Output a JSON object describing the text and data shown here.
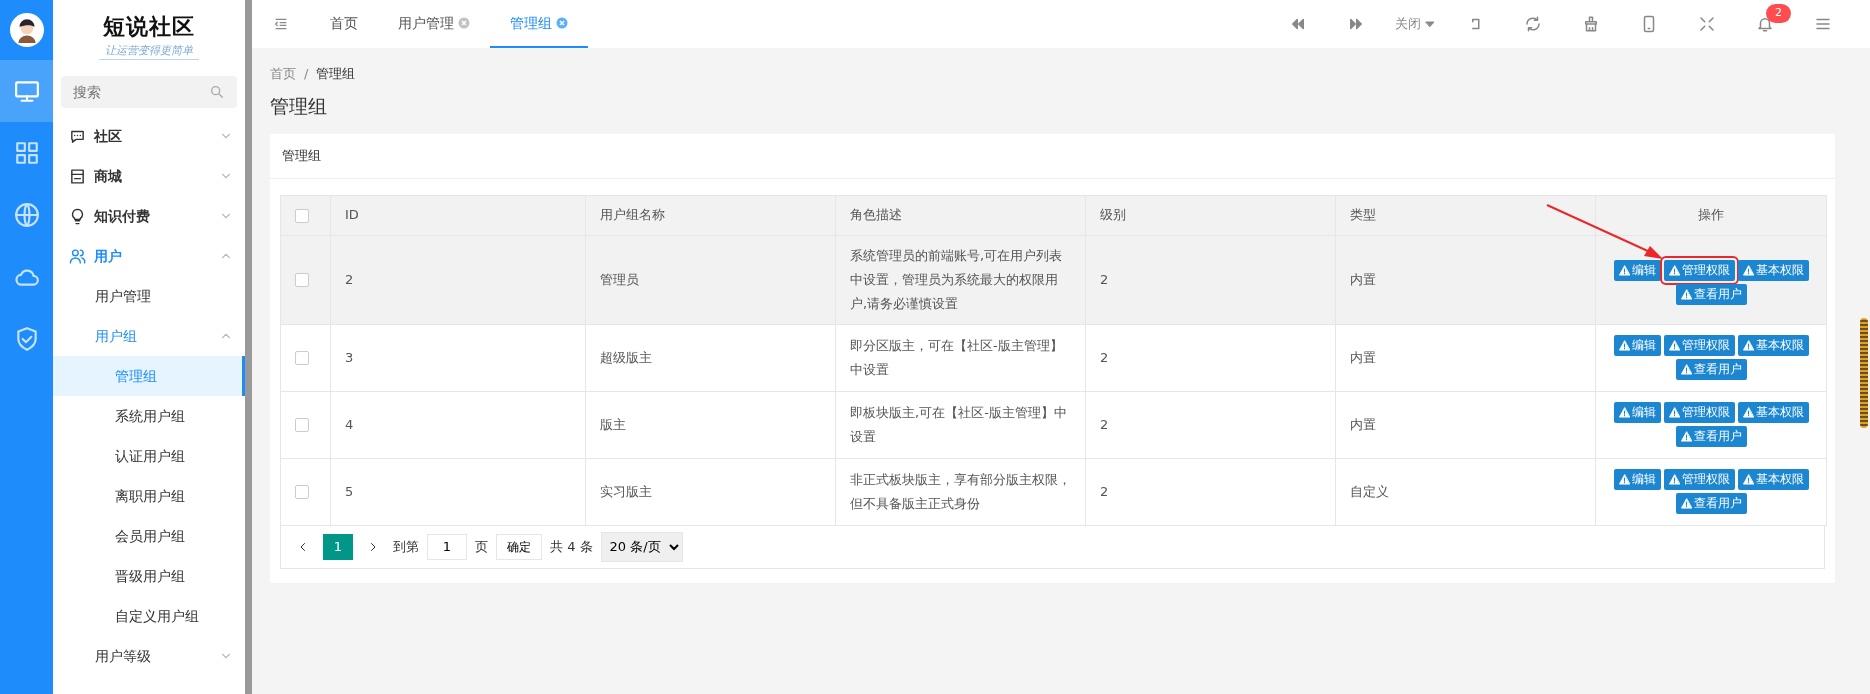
{
  "rail": [
    {
      "kind": "monitor",
      "selected": true
    },
    {
      "kind": "grid",
      "selected": false
    },
    {
      "kind": "globe",
      "selected": false
    },
    {
      "kind": "cloud",
      "selected": false
    },
    {
      "kind": "shield",
      "selected": false
    }
  ],
  "logo": {
    "title": "短说社区",
    "tagline": "让运营变得更简单"
  },
  "search": {
    "placeholder": "搜索"
  },
  "menu": [
    {
      "label": "社区",
      "kind": "chat",
      "active": false,
      "expanded": false
    },
    {
      "label": "商城",
      "kind": "store",
      "active": false,
      "expanded": false
    },
    {
      "label": "知识付费",
      "kind": "bulb",
      "active": false,
      "expanded": false
    },
    {
      "label": "用户",
      "kind": "users",
      "active": true,
      "expanded": true,
      "children": [
        {
          "label": "用户管理",
          "active": false
        },
        {
          "label": "用户组",
          "active": true,
          "expanded": true,
          "children": [
            {
              "label": "管理组",
              "selected": true
            },
            {
              "label": "系统用户组",
              "selected": false
            },
            {
              "label": "认证用户组",
              "selected": false
            },
            {
              "label": "离职用户组",
              "selected": false
            },
            {
              "label": "会员用户组",
              "selected": false
            },
            {
              "label": "晋级用户组",
              "selected": false
            },
            {
              "label": "自定义用户组",
              "selected": false
            }
          ]
        },
        {
          "label": "用户等级",
          "active": false,
          "expanded": false
        }
      ]
    }
  ],
  "tabs": [
    {
      "label": "首页",
      "selected": false,
      "closable": false
    },
    {
      "label": "用户管理",
      "selected": false,
      "closable": true
    },
    {
      "label": "管理组",
      "selected": true,
      "closable": true
    }
  ],
  "toolbar": {
    "close_menu": "关闭",
    "notifications": "2",
    "tools": [
      {
        "kind": "first"
      },
      {
        "kind": "last"
      },
      {
        "kind": "close"
      },
      {
        "kind": "back"
      },
      {
        "kind": "refresh"
      },
      {
        "kind": "clean"
      },
      {
        "kind": "mobile"
      },
      {
        "kind": "fullscreen"
      },
      {
        "kind": "bell"
      },
      {
        "kind": "menu"
      }
    ]
  },
  "breadcrumb": {
    "items": [
      "首页",
      "管理组"
    ],
    "separator": "/"
  },
  "page_title": "管理组",
  "card_title": "管理组",
  "table": {
    "select_all": {
      "checked": false
    },
    "columns": [
      "ID",
      "用户组名称",
      "角色描述",
      "级别",
      "类型",
      "操作"
    ],
    "rows": [
      {
        "checked": false,
        "hovered": true,
        "id": "2",
        "name": "管理员",
        "description": "系统管理员的前端账号,可在用户列表中设置，管理员为系统最大的权限用户,请务必谨慎设置",
        "level": "2",
        "type": "内置",
        "actions": [
          {
            "label": "编辑",
            "highlighted": false
          },
          {
            "label": "管理权限",
            "highlighted": true
          },
          {
            "label": "基本权限",
            "highlighted": false
          },
          {
            "label": "查看用户",
            "highlighted": false
          }
        ]
      },
      {
        "checked": false,
        "hovered": false,
        "id": "3",
        "name": "超级版主",
        "description": "即分区版主，可在【社区-版主管理】中设置",
        "level": "2",
        "type": "内置",
        "actions": [
          {
            "label": "编辑",
            "highlighted": false
          },
          {
            "label": "管理权限",
            "highlighted": false
          },
          {
            "label": "基本权限",
            "highlighted": false
          },
          {
            "label": "查看用户",
            "highlighted": false
          }
        ]
      },
      {
        "checked": false,
        "hovered": false,
        "id": "4",
        "name": "版主",
        "description": "即板块版主,可在【社区-版主管理】中设置",
        "level": "2",
        "type": "内置",
        "actions": [
          {
            "label": "编辑",
            "highlighted": false
          },
          {
            "label": "管理权限",
            "highlighted": false
          },
          {
            "label": "基本权限",
            "highlighted": false
          },
          {
            "label": "查看用户",
            "highlighted": false
          }
        ]
      },
      {
        "checked": false,
        "hovered": false,
        "id": "5",
        "name": "实习版主",
        "description": "非正式板块版主，享有部分版主权限，但不具备版主正式身份",
        "level": "2",
        "type": "自定义",
        "actions": [
          {
            "label": "编辑",
            "highlighted": false
          },
          {
            "label": "管理权限",
            "highlighted": false
          },
          {
            "label": "基本权限",
            "highlighted": false
          },
          {
            "label": "查看用户",
            "highlighted": false
          }
        ]
      }
    ]
  },
  "pagination": {
    "pages": [
      {
        "label": "1",
        "selected": true
      }
    ],
    "goto_label": "到第",
    "page_input": "1",
    "page_unit": "页",
    "confirm": "确定",
    "total": "共 4 条",
    "page_size": "20 条/页"
  }
}
